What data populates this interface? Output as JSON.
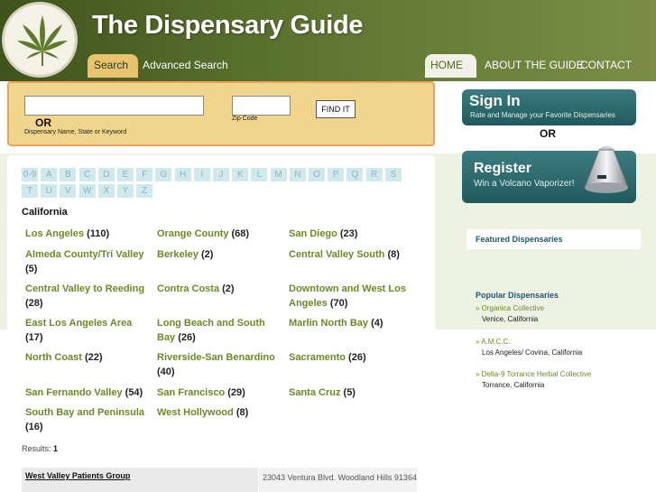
{
  "header": {
    "site_title": "The Dispensary Guide",
    "tabs": [
      "Search",
      "Advanced Search"
    ],
    "nav": [
      "HOME",
      "ABOUT THE GUIDE",
      "CONTACT"
    ]
  },
  "search": {
    "name_value": "",
    "or_label": "OR",
    "name_caption": "Dispensary Name, State or Keyword",
    "zip_value": "",
    "zip_caption": "Zip Code",
    "button_label": "FIND IT"
  },
  "alphabet": [
    "0-9",
    "A",
    "B",
    "C",
    "D",
    "E",
    "F",
    "G",
    "H",
    "I",
    "J",
    "K",
    "L",
    "M",
    "N",
    "O",
    "P",
    "Q",
    "R",
    "S",
    "T",
    "U",
    "V",
    "W",
    "X",
    "Y",
    "Z"
  ],
  "state_title": "California",
  "cities": [
    {
      "name": "Los Angeles",
      "count": "(110)"
    },
    {
      "name": "Orange County",
      "count": "(68)"
    },
    {
      "name": "San Diego",
      "count": "(23)"
    },
    {
      "name": "Almeda County/Tri Valley",
      "count": "(5)"
    },
    {
      "name": "Berkeley",
      "count": "(2)"
    },
    {
      "name": "Central Valley South",
      "count": "(8)"
    },
    {
      "name": "Central Valley to Reeding",
      "count": "(28)"
    },
    {
      "name": "Contra Costa",
      "count": "(2)"
    },
    {
      "name": "Downtown and West Los Angeles",
      "count": "(70)"
    },
    {
      "name": "East Los Angeles Area",
      "count": "(17)"
    },
    {
      "name": "Long Beach and South Bay",
      "count": "(26)"
    },
    {
      "name": "Marlin North Bay",
      "count": "(4)"
    },
    {
      "name": "North Coast",
      "count": "(22)"
    },
    {
      "name": "Riverside-San Benardino",
      "count": "(40)"
    },
    {
      "name": "Sacramento",
      "count": "(26)"
    },
    {
      "name": "San Fernando Valley",
      "count": "(54)"
    },
    {
      "name": "San Francisco",
      "count": "(29)"
    },
    {
      "name": "Santa Cruz",
      "count": "(5)"
    },
    {
      "name": "South Bay and Peninsula",
      "count": "(16)"
    },
    {
      "name": "West Hollywood",
      "count": "(8)"
    }
  ],
  "results": {
    "label": "Results:",
    "count": "1",
    "rows": [
      {
        "name": "West Valley Patients Group",
        "address": "23043 Ventura Blvd. Woodland Hills 91364"
      }
    ]
  },
  "sidebar": {
    "signin_title": "Sign In",
    "signin_sub": "Rate and Manage your Favorite Dispensaries",
    "or_label": "OR",
    "register_title": "Register",
    "register_sub": "Win a Volcano Vaporizer!",
    "featured_title": "Featured Dispensaries",
    "popular_title": "Popular Dispensaries",
    "popular": [
      {
        "name": "» Organica Collective",
        "location": "Venice, California"
      },
      {
        "name": "» A.M.C.C.",
        "location": "Los Angeles/ Covina, California"
      },
      {
        "name": "» Delta-9 Torrance Herbal Collective",
        "location": "Torrance, California"
      }
    ]
  },
  "colors": {
    "header_green": "#5c7430",
    "link_green": "#6a8b24",
    "search_panel": "#f2d58c",
    "banner_teal": "#2f6e72"
  }
}
